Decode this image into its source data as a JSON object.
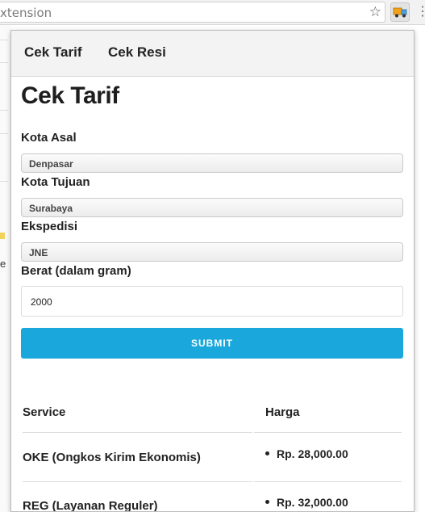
{
  "browser": {
    "address_text": "xtension",
    "bookmark_icon": "star-icon",
    "extension_icon": "truck-icon",
    "menu_icon": "kebab-menu-icon",
    "page_behind_letter": "e"
  },
  "nav": {
    "items": [
      {
        "label": "Cek Tarif"
      },
      {
        "label": "Cek Resi"
      }
    ]
  },
  "form": {
    "title": "Cek Tarif",
    "origin_label": "Kota Asal",
    "origin_value": "Denpasar",
    "destination_label": "Kota Tujuan",
    "destination_value": "Surabaya",
    "courier_label": "Ekspedisi",
    "courier_value": "JNE",
    "weight_label": "Berat (dalam gram)",
    "weight_value": "2000",
    "submit_label": "SUBMIT"
  },
  "results": {
    "columns": [
      "Service",
      "Harga"
    ],
    "rows": [
      {
        "service": "OKE (Ongkos Kirim Ekonomis)",
        "price": "Rp. 28,000.00"
      },
      {
        "service": "REG (Layanan Reguler)",
        "price": "Rp. 32,000.00"
      }
    ]
  },
  "colors": {
    "accent": "#1aa7dc",
    "navbar_bg": "#f3f3f3"
  }
}
